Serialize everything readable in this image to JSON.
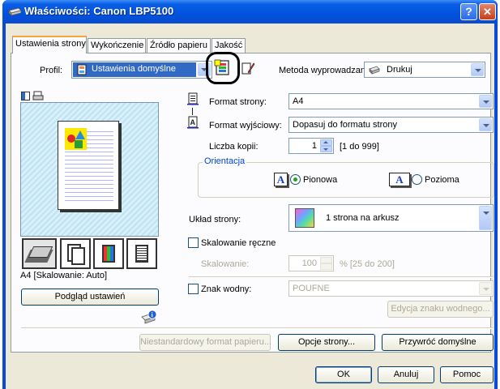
{
  "window": {
    "title": "Właściwości: Canon LBP5100",
    "help": "?",
    "close": "✕"
  },
  "tabs": [
    "Ustawienia strony",
    "Wykończenie",
    "Źródło papieru",
    "Jakość"
  ],
  "profile": {
    "label": "Profil:",
    "value": "Ustawienia domyślne"
  },
  "output": {
    "label": "Metoda wyprowadzania:",
    "value": "Drukuj"
  },
  "page_size": {
    "label": "Format strony:",
    "value": "A4"
  },
  "output_size": {
    "label": "Format wyjściowy:",
    "value": "Dopasuj do formatu strony"
  },
  "copies": {
    "label": "Liczba kopii:",
    "value": "1",
    "range": "[1 do 999]"
  },
  "orientation": {
    "label": "Orientacja",
    "portrait": "Pionowa",
    "landscape": "Pozioma",
    "icon_letter": "A"
  },
  "layout": {
    "label": "Układ strony:",
    "value": "1 strona na arkusz"
  },
  "manual_scaling": {
    "label": "Skalowanie ręczne"
  },
  "scaling": {
    "label": "Skalowanie:",
    "value": "100",
    "range": "% [25 do 200]"
  },
  "watermark": {
    "label": "Znak wodny:",
    "value": "POUFNE",
    "edit_button": "Edycja znaku wodnego..."
  },
  "preview": {
    "status": "A4 [Skalowanie: Auto]",
    "button": "Podgląd ustawień"
  },
  "bottom_buttons": {
    "custom_paper": "Niestandardowy format papieru...",
    "page_options": "Opcje strony...",
    "restore": "Przywróć domyślne"
  },
  "dialog_buttons": {
    "ok": "OK",
    "cancel": "Anuluj",
    "help": "Pomoc"
  }
}
